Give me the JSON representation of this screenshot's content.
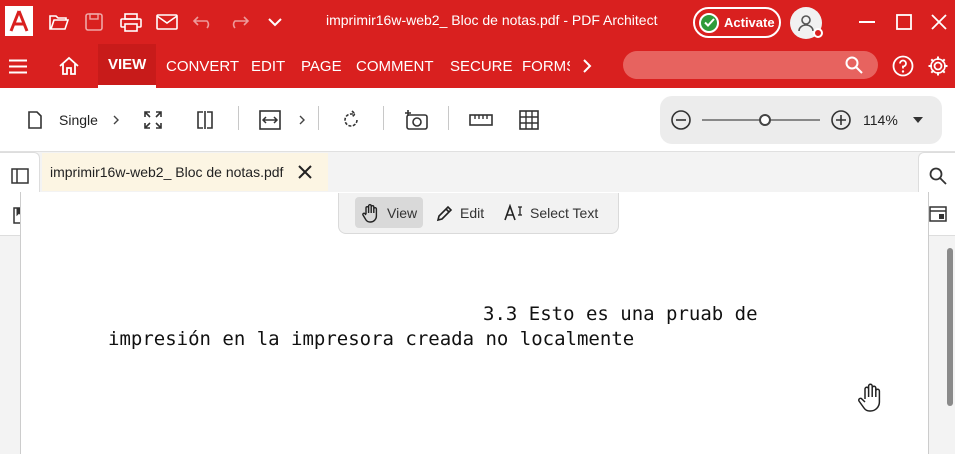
{
  "window": {
    "title": "imprimir16w-web2_ Bloc de notas.pdf  -  PDF Architect",
    "activate_label": "Activate"
  },
  "ribbon": {
    "tabs": [
      {
        "label": "VIEW",
        "active": true
      },
      {
        "label": "CONVERT"
      },
      {
        "label": "EDIT"
      },
      {
        "label": "PAGE"
      },
      {
        "label": "COMMENT"
      },
      {
        "label": "SECURE"
      },
      {
        "label": "FORMS"
      }
    ]
  },
  "toolbar": {
    "page_mode_label": "Single",
    "zoom_level": "114%",
    "zoom_fraction": 0.5
  },
  "document": {
    "tab_label": "imprimir16w-web2_ Bloc de notas.pdf",
    "line1": "3.3 Esto es una pruab de",
    "line2": "impresión en la impresora creada no localmente"
  },
  "modes": {
    "view": "View",
    "edit": "Edit",
    "select_text": "Select Text"
  },
  "colors": {
    "brand": "#d9201f",
    "activate_check": "#2e9b3a",
    "doc_tab_bg": "#fcf5e3"
  }
}
